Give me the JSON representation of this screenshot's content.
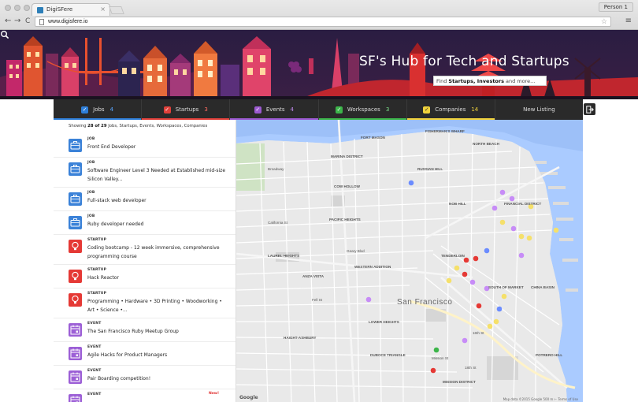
{
  "browser": {
    "tab_title": "DigiSFere",
    "tab_close": "×",
    "profile": "Person 1",
    "url": "www.digisfere.io",
    "back": "←",
    "forward": "→",
    "reload": "C",
    "star": "☆",
    "menu": "≡"
  },
  "banner": {
    "headline": "SF's Hub for Tech and Startups",
    "search_prefix": "Find ",
    "search_bold": "Startups, Investors",
    "search_suffix": " and more..."
  },
  "nav": {
    "items": [
      {
        "label": "Jobs",
        "count": "4",
        "color": "#2e7ed8"
      },
      {
        "label": "Startups",
        "count": "3",
        "color": "#e0403a"
      },
      {
        "label": "Events",
        "count": "4",
        "color": "#9b59d0"
      },
      {
        "label": "Workspaces",
        "count": "3",
        "color": "#3cb54a"
      },
      {
        "label": "Companies",
        "count": "14",
        "color": "#f0d23c"
      },
      {
        "label": "New Listing",
        "count": "",
        "color": ""
      }
    ],
    "logout_icon": "logout-icon"
  },
  "panel": {
    "showing_prefix": "Showing ",
    "showing_bold": "28 of 29",
    "showing_suffix": " Jobs, Startups, Events, Workspaces, Companies",
    "items": [
      {
        "type": "JOB",
        "title": "Front End Developer",
        "kind": "job"
      },
      {
        "type": "JOB",
        "title": "Software Engineer Level 3 Needed at Established mid-size Silicon Valley...",
        "kind": "job"
      },
      {
        "type": "JOB",
        "title": "Full-stack web developer",
        "kind": "job"
      },
      {
        "type": "JOB",
        "title": "Ruby developer needed",
        "kind": "job"
      },
      {
        "type": "STARTUP",
        "title": "Coding bootcamp - 12 week immersive, comprehensive programming course",
        "kind": "startup"
      },
      {
        "type": "STARTUP",
        "title": "Hack Reactor",
        "kind": "startup"
      },
      {
        "type": "STARTUP",
        "title": "Programming • Hardware • 3D Printing • Woodworking • Art • Science •...",
        "kind": "startup"
      },
      {
        "type": "EVENT",
        "title": "The San Francisco Ruby Meetup Group",
        "kind": "event"
      },
      {
        "type": "EVENT",
        "title": "Agile Hacks for Product Managers",
        "kind": "event"
      },
      {
        "type": "EVENT",
        "title": "Pair Boarding competition!",
        "kind": "event"
      },
      {
        "type": "EVENT",
        "title": "",
        "kind": "event",
        "badge": "New!"
      }
    ],
    "colors": {
      "job": "#3b82d8",
      "startup": "#e53935",
      "event": "#9c5fd6"
    }
  },
  "map": {
    "city": "San Francisco",
    "credit": "Map data ©2015 Google   500 m ⊢   Terms of Use",
    "google": "Google",
    "labels": [
      {
        "t": "FORT MASON",
        "cls": "n"
      },
      {
        "t": "FISHERMAN'S WHARF",
        "cls": "n"
      },
      {
        "t": "NORTH BEACH",
        "cls": "n"
      },
      {
        "t": "MARINA DISTRICT",
        "cls": "n"
      },
      {
        "t": "RUSSIAN HILL",
        "cls": "n"
      },
      {
        "t": "COW HOLLOW",
        "cls": "n"
      },
      {
        "t": "NOB HILL",
        "cls": "n"
      },
      {
        "t": "FINANCIAL DISTRICT",
        "cls": "n"
      },
      {
        "t": "PACIFIC HEIGHTS",
        "cls": "n"
      },
      {
        "t": "LAUREL HEIGHTS",
        "cls": "n"
      },
      {
        "t": "TENDERLOIN",
        "cls": "n"
      },
      {
        "t": "WESTERN ADDITION",
        "cls": "n"
      },
      {
        "t": "ANZA VISTA",
        "cls": "n"
      },
      {
        "t": "SOUTH OF MARKET",
        "cls": "n"
      },
      {
        "t": "CHINA BASIN",
        "cls": "n"
      },
      {
        "t": "LOWER HEIGHTS",
        "cls": "n"
      },
      {
        "t": "HAIGHT-ASHBURY",
        "cls": "n"
      },
      {
        "t": "DUBOCE TRIANGLE",
        "cls": "n"
      },
      {
        "t": "POTRERO HILL",
        "cls": "n"
      },
      {
        "t": "MISSION DISTRICT",
        "cls": "n"
      },
      {
        "t": "Broadway",
        "cls": "s"
      },
      {
        "t": "California St",
        "cls": "s"
      },
      {
        "t": "Geary Blvd",
        "cls": "s"
      },
      {
        "t": "Fell St",
        "cls": "s"
      },
      {
        "t": "16th St",
        "cls": "s"
      },
      {
        "t": "18th St",
        "cls": "s"
      },
      {
        "t": "Mission St",
        "cls": "s"
      }
    ]
  }
}
